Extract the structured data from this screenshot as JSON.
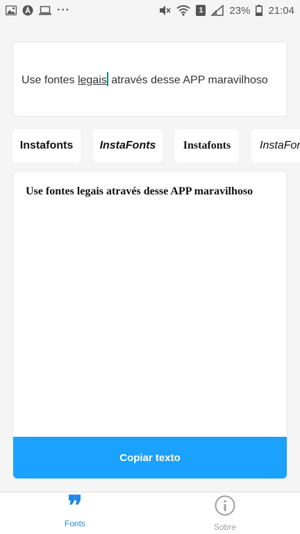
{
  "status_bar": {
    "left_icons": [
      "image-icon",
      "alert-a-icon",
      "laptop-icon"
    ],
    "more": "···",
    "right_icons": [
      "mute-icon",
      "wifi-icon",
      "sim-1-icon",
      "signal-icon",
      "battery-icon"
    ],
    "sim_label": "1",
    "battery": "23%",
    "time": "21:04"
  },
  "input": {
    "before": "Use fontes ",
    "underlined": "legais",
    "after": " através desse APP maravilhoso"
  },
  "font_chips": [
    {
      "label": "Instafonts"
    },
    {
      "label": "InstaFonts"
    },
    {
      "label": "Instafonts"
    },
    {
      "label": "InstaFonts"
    }
  ],
  "output": {
    "text": "Use fontes legais através desse APP maravilhoso"
  },
  "copy_button": {
    "label": "Copiar texto",
    "color": "#1ba1ff"
  },
  "bottom_nav": {
    "items": [
      {
        "label": "Fonts",
        "icon": "quote-icon",
        "active": true,
        "color": "#1e88e5"
      },
      {
        "label": "Sobre",
        "icon": "info-icon",
        "active": false,
        "color": "#9e9e9e"
      }
    ]
  }
}
